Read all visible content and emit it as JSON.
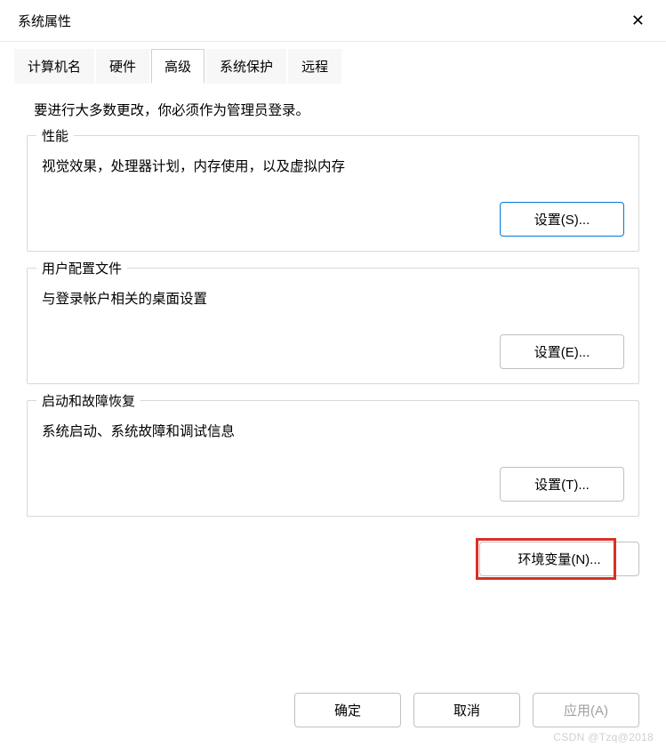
{
  "window": {
    "title": "系统属性",
    "close_icon": "✕"
  },
  "tabs": [
    {
      "label": "计算机名"
    },
    {
      "label": "硬件"
    },
    {
      "label": "高级"
    },
    {
      "label": "系统保护"
    },
    {
      "label": "远程"
    }
  ],
  "intro": "要进行大多数更改，你必须作为管理员登录。",
  "groups": {
    "performance": {
      "legend": "性能",
      "desc": "视觉效果，处理器计划，内存使用，以及虚拟内存",
      "btn": "设置(S)..."
    },
    "profiles": {
      "legend": "用户配置文件",
      "desc": "与登录帐户相关的桌面设置",
      "btn": "设置(E)..."
    },
    "startup": {
      "legend": "启动和故障恢复",
      "desc": "系统启动、系统故障和调试信息",
      "btn": "设置(T)..."
    }
  },
  "env_button": "环境变量(N)...",
  "footer": {
    "ok": "确定",
    "cancel": "取消",
    "apply": "应用(A)"
  },
  "watermark": "CSDN @Tzq@2018"
}
